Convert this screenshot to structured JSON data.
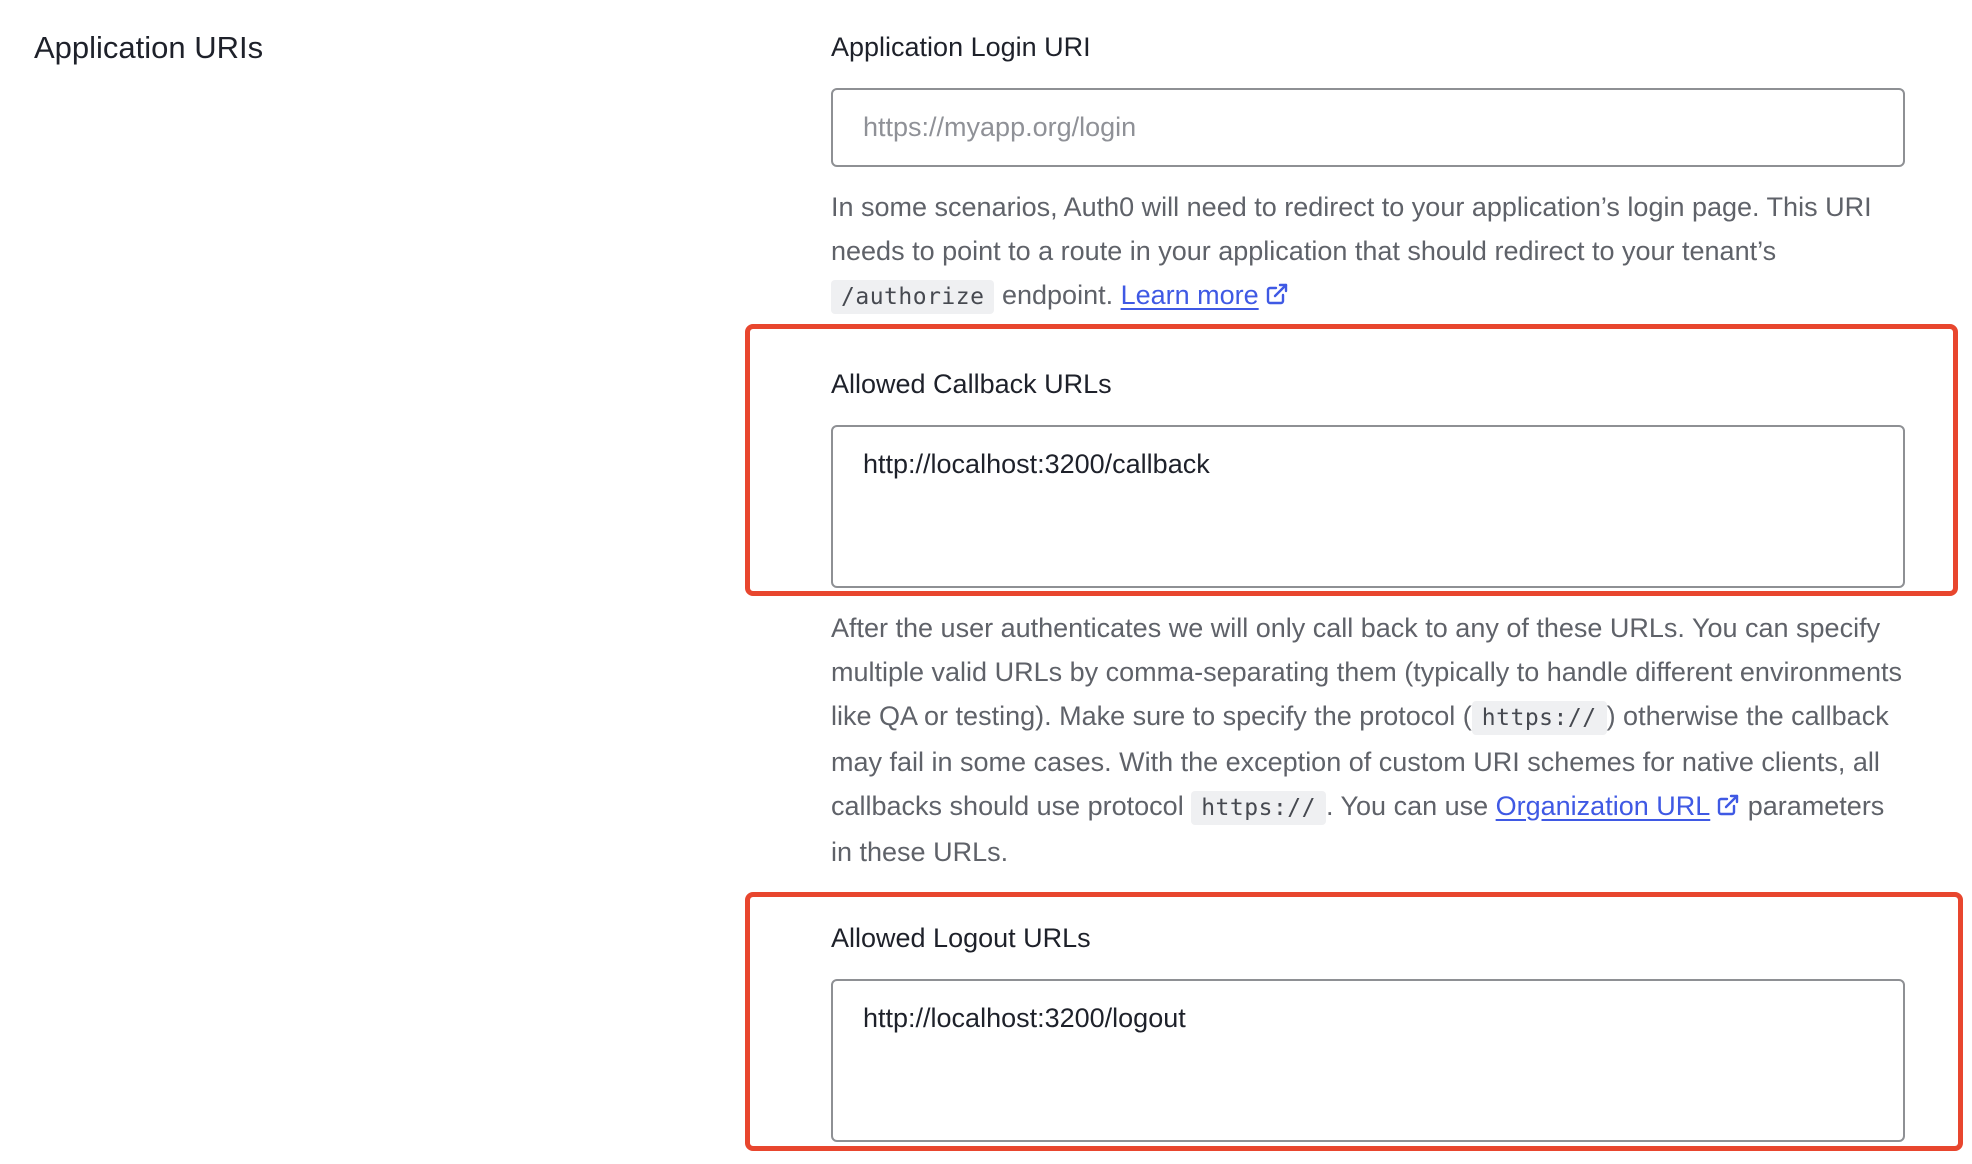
{
  "section": {
    "title": "Application URIs"
  },
  "login_uri": {
    "label": "Application Login URI",
    "value": "",
    "placeholder": "https://myapp.org/login",
    "help_part1": "In some scenarios, Auth0 will need to redirect to your application’s login page. This URI needs to point to a route in your application that should redirect to your tenant’s ",
    "help_code": "/authorize",
    "help_part2": " endpoint. ",
    "help_link": "Learn more"
  },
  "callback_urls": {
    "label": "Allowed Callback URLs",
    "value": "http://localhost:3200/callback",
    "help_part1": "After the user authenticates we will only call back to any of these URLs. You can specify multiple valid URLs by comma-separating them (typically to handle different environments like QA or testing). Make sure to specify the protocol (",
    "help_code1": "https://",
    "help_part2": ") otherwise the callback may fail in some cases. With the exception of custom URI schemes for native clients, all callbacks should use protocol ",
    "help_code2": "https://",
    "help_part3": ". You can use ",
    "help_link": "Organization URL",
    "help_part4": " parameters in these URLs."
  },
  "logout_urls": {
    "label": "Allowed Logout URLs",
    "value": "http://localhost:3200/logout"
  },
  "colors": {
    "highlight": "#e8462e",
    "link": "#3f59e4",
    "help_text": "#5f6269",
    "input_border": "#8e9094"
  },
  "icons": {
    "external_link": "external-link-icon"
  }
}
